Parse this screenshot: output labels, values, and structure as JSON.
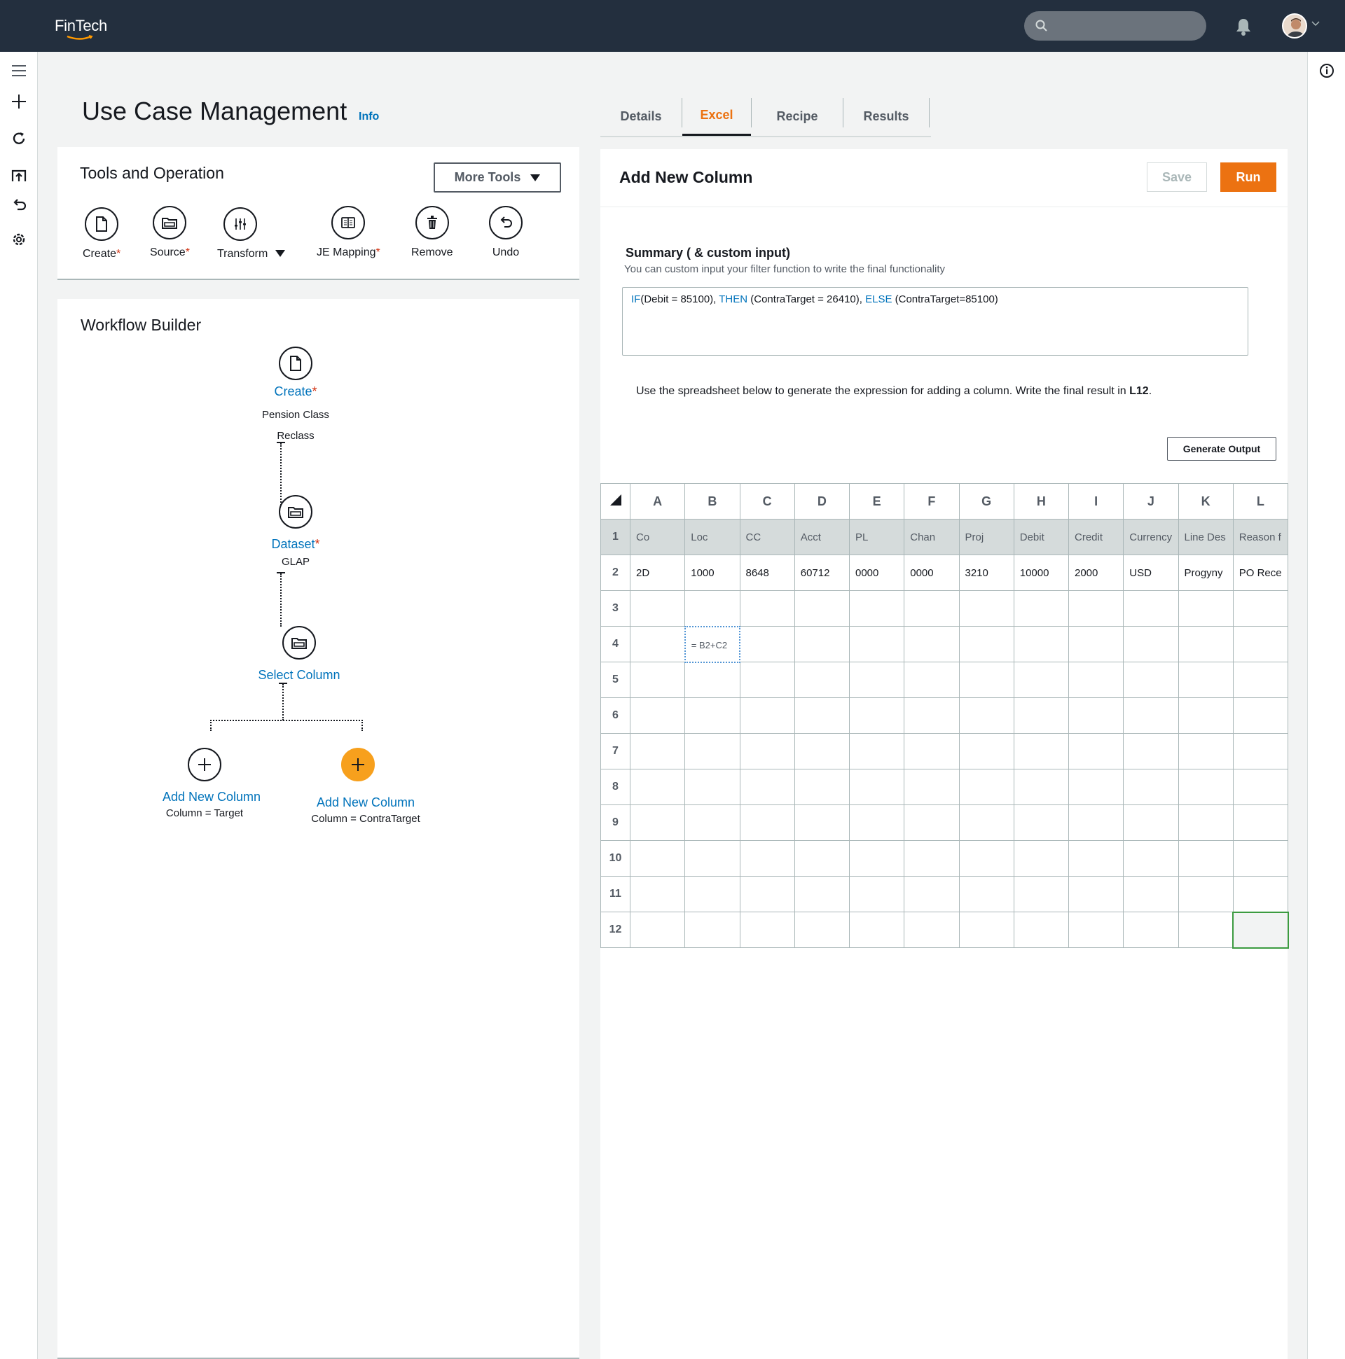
{
  "app": {
    "logo_text": "FinTech",
    "search_placeholder": ""
  },
  "rail": {
    "icons": [
      "menu-icon",
      "plus-icon",
      "refresh-icon",
      "import-icon",
      "undo-icon",
      "settings-icon"
    ]
  },
  "page": {
    "title": "Use Case Management",
    "info_label": "Info"
  },
  "tabs": [
    {
      "label": "Details",
      "active": false
    },
    {
      "label": "Excel",
      "active": true
    },
    {
      "label": "Recipe",
      "active": false
    },
    {
      "label": "Results",
      "active": false
    }
  ],
  "tools": {
    "title": "Tools and Operation",
    "more_tools_label": "More Tools",
    "items": [
      {
        "label": "Create",
        "required": true,
        "icon": "document-icon"
      },
      {
        "label": "Source",
        "required": true,
        "icon": "folder-icon"
      },
      {
        "label": "Transform",
        "required": false,
        "icon": "sliders-icon",
        "dropdown": true
      },
      {
        "label": "JE Mapping",
        "required": true,
        "icon": "ledger-icon"
      },
      {
        "label": "Remove",
        "required": false,
        "icon": "trash-icon"
      },
      {
        "label": "Undo",
        "required": false,
        "icon": "undo-icon"
      }
    ]
  },
  "workflow": {
    "title": "Workflow Builder",
    "nodes": [
      {
        "label": "Create",
        "required": true,
        "sub1": "Pension Class",
        "sub2": "Reclass"
      },
      {
        "label": "Dataset",
        "required": true,
        "sub1": "GLAP"
      },
      {
        "label": "Select Column"
      },
      {
        "label": "Add New Column",
        "sub1": "Column = Target"
      },
      {
        "label": "Add New Column",
        "sub1": "Column = ContraTarget"
      }
    ]
  },
  "editor": {
    "title": "Add New Column",
    "save_label": "Save",
    "run_label": "Run",
    "summary_label": "Summary ( & custom input)",
    "summary_desc": "You can custom input your filter function to write the final functionality",
    "formula": {
      "kw_if": "IF",
      "part1": "(Debit = 85100), ",
      "kw_then": "THEN",
      "part2": " (ContraTarget = 26410), ",
      "kw_else": "ELSE",
      "part3": " (ContraTarget=85100)"
    },
    "instruction_prefix": "Use the spreadsheet below to generate the expression for adding a column. Write the final result in ",
    "instruction_cell": "L12",
    "instruction_suffix": ".",
    "generate_label": "Generate Output"
  },
  "sheet": {
    "columns": [
      "A",
      "B",
      "C",
      "D",
      "E",
      "F",
      "G",
      "H",
      "I",
      "J",
      "K",
      "L"
    ],
    "row_numbers": [
      "1",
      "2",
      "3",
      "4",
      "5",
      "6",
      "7",
      "8",
      "9",
      "10",
      "11",
      "12"
    ],
    "header_row": [
      "Co",
      "Loc",
      "CC",
      "Acct",
      "PL",
      "Chan",
      "Proj",
      "Debit",
      "Credit",
      "Currency",
      "Line Des",
      "Reason f"
    ],
    "data_row": [
      "2D",
      "1000",
      "8648",
      "60712",
      "0000",
      "0000",
      "3210",
      "10000",
      "2000",
      "USD",
      "Progyny",
      "PO Rece"
    ],
    "formula_cell": {
      "row": 4,
      "col": "B",
      "text": "= B2+C2"
    },
    "target_cell": {
      "row": 12,
      "col": "L"
    }
  }
}
